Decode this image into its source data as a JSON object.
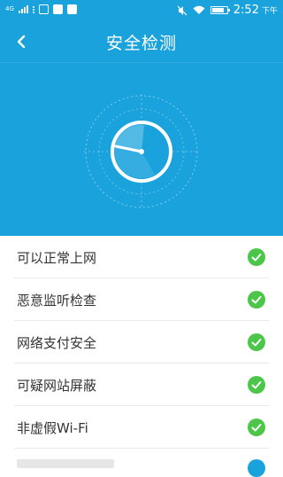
{
  "status_bar": {
    "network": "4G",
    "time": "2:52",
    "ampm": "下午"
  },
  "header": {
    "title": "安全检测"
  },
  "checks": [
    {
      "label": "可以正常上网",
      "status": "passed"
    },
    {
      "label": "恶意监听检查",
      "status": "passed"
    },
    {
      "label": "网络支付安全",
      "status": "passed"
    },
    {
      "label": "可疑网站屏蔽",
      "status": "passed"
    },
    {
      "label": "非虚假Wi-Fi",
      "status": "passed"
    }
  ],
  "colors": {
    "primary": "#1aa2dc",
    "success": "#4cc64a",
    "text": "#333333"
  },
  "icons": [
    "back-arrow-icon",
    "radar-gauge-icon",
    "check-icon",
    "wifi-icon",
    "battery-icon",
    "mute-icon"
  ]
}
